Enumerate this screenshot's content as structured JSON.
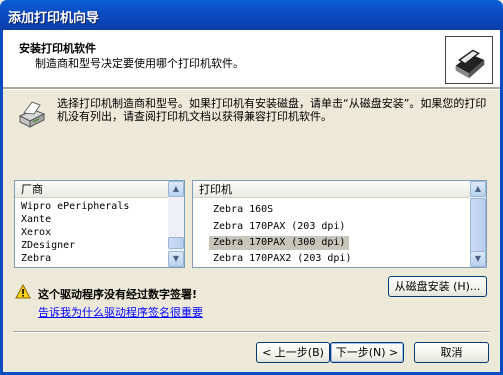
{
  "window": {
    "title": "添加打印机向导"
  },
  "header": {
    "title": "安装打印机软件",
    "subtitle": "制造商和型号决定要使用哪个打印机软件。",
    "icon": "printer-setup-icon"
  },
  "intro": {
    "icon": "printer-icon",
    "text": "选择打印机制造商和型号。如果打印机有安装磁盘，请单击“从磁盘安装”。如果您的打印机没有列出，请查阅打印机文档以获得兼容打印机软件。"
  },
  "manufacturer_list": {
    "header": "厂商",
    "items": [
      "Wipro ePeripherals",
      "Xante",
      "Xerox",
      "ZDesigner",
      "Zebra"
    ]
  },
  "printer_list": {
    "header": "打印机",
    "items": [
      "Zebra 160S",
      "Zebra 170PAX (203 dpi)",
      "Zebra 170PAX (300 dpi)",
      "Zebra 170PAX2 (203 dpi)"
    ],
    "selected_index": 2
  },
  "warning": {
    "icon": "warning-icon",
    "text": "这个驱动程序没有经过数字签署!",
    "link": "告诉我为什么驱动程序签名很重要"
  },
  "buttons": {
    "have_disk": "从磁盘安装 (H)...",
    "back": "< 上一步(B)",
    "next": "下一步(N) >",
    "cancel": "取消"
  },
  "colors": {
    "titlebar": "#0b4cc3",
    "face": "#ece9d8",
    "selection": "#c8c5bb",
    "link": "#0000ff"
  }
}
